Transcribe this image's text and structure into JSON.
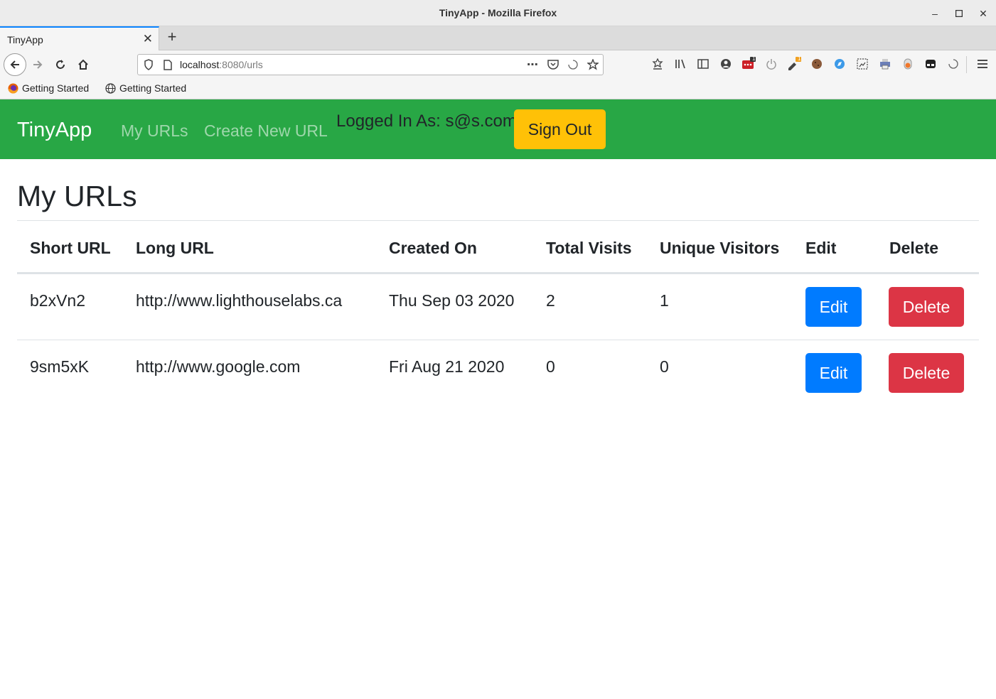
{
  "window": {
    "title": "TinyApp - Mozilla Firefox"
  },
  "tab": {
    "label": "TinyApp"
  },
  "urlbar": {
    "host": "localhost",
    "path": ":8080/urls"
  },
  "bookmarks": [
    {
      "label": "Getting Started",
      "icon": "firefox-icon"
    },
    {
      "label": "Getting Started",
      "icon": "globe-icon"
    }
  ],
  "badges": {
    "extension_one": "1",
    "extension_two": "1"
  },
  "app": {
    "brand": "TinyApp",
    "nav": {
      "my_urls": "My URLs",
      "create_new": "Create New URL"
    },
    "logged_in": "Logged In As: s@s.com",
    "sign_out": "Sign Out",
    "colors": {
      "navbar": "#28a745",
      "signout": "#ffc107",
      "edit": "#007bff",
      "delete": "#dc3545"
    }
  },
  "page": {
    "title": "My URLs",
    "columns": [
      "Short URL",
      "Long URL",
      "Created On",
      "Total Visits",
      "Unique Visitors",
      "Edit",
      "Delete"
    ],
    "rows": [
      {
        "short": "b2xVn2",
        "long": "http://www.lighthouselabs.ca",
        "created": "Thu Sep 03 2020",
        "total": "2",
        "unique": "1",
        "edit": "Edit",
        "delete": "Delete"
      },
      {
        "short": "9sm5xK",
        "long": "http://www.google.com",
        "created": "Fri Aug 21 2020",
        "total": "0",
        "unique": "0",
        "edit": "Edit",
        "delete": "Delete"
      }
    ]
  }
}
